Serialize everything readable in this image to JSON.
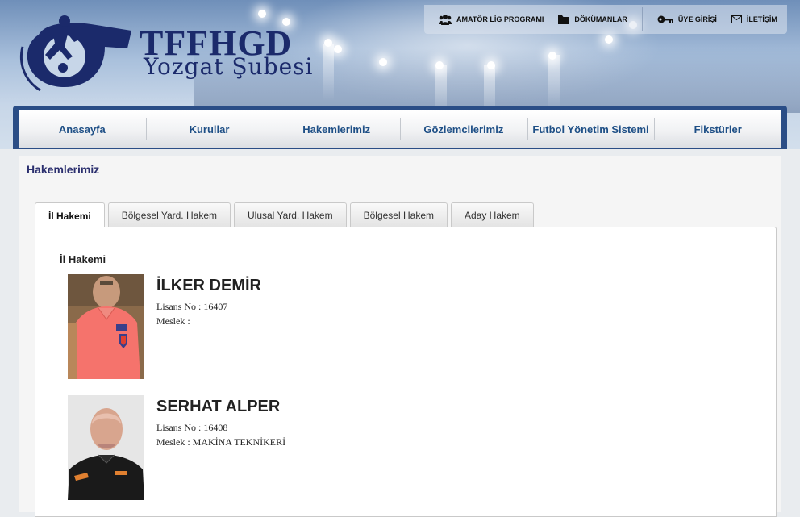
{
  "brand": {
    "title": "TFFHGD",
    "subtitle": "Yozgat Şubesi"
  },
  "top_links": [
    {
      "label": "AMATÖR LİG PROGRAMI",
      "icon": "people-icon"
    },
    {
      "label": "DÖKÜMANLAR",
      "icon": "folder-icon"
    },
    {
      "label": "ÜYE GİRİŞİ",
      "icon": "key-icon"
    },
    {
      "label": "İLETİŞİM",
      "icon": "envelope-icon"
    }
  ],
  "nav": [
    "Anasayfa",
    "Kurullar",
    "Hakemlerimiz",
    "Gözlemcilerimiz",
    "Futbol Yönetim Sistemi",
    "Fikstürler"
  ],
  "page_title": "Hakemlerimiz",
  "tabs": [
    {
      "label": "İl Hakemi",
      "active": true
    },
    {
      "label": "Bölgesel Yard. Hakem",
      "active": false
    },
    {
      "label": "Ulusal Yard. Hakem",
      "active": false
    },
    {
      "label": "Bölgesel Hakem",
      "active": false
    },
    {
      "label": "Aday Hakem",
      "active": false
    }
  ],
  "section_title": "İl Hakemi",
  "referees": [
    {
      "name": "İLKER DEMİR",
      "license": "Lisans No : 16407",
      "job": "Meslek :"
    },
    {
      "name": "SERHAT ALPER",
      "license": "Lisans No : 16408",
      "job": "Meslek : MAKİNA TEKNİKERİ"
    }
  ],
  "colors": {
    "brand_navy": "#1b2a6b",
    "nav_text": "#1e4f86",
    "nav_frame": "#2a4d86",
    "page_title": "#2b2f6e"
  }
}
